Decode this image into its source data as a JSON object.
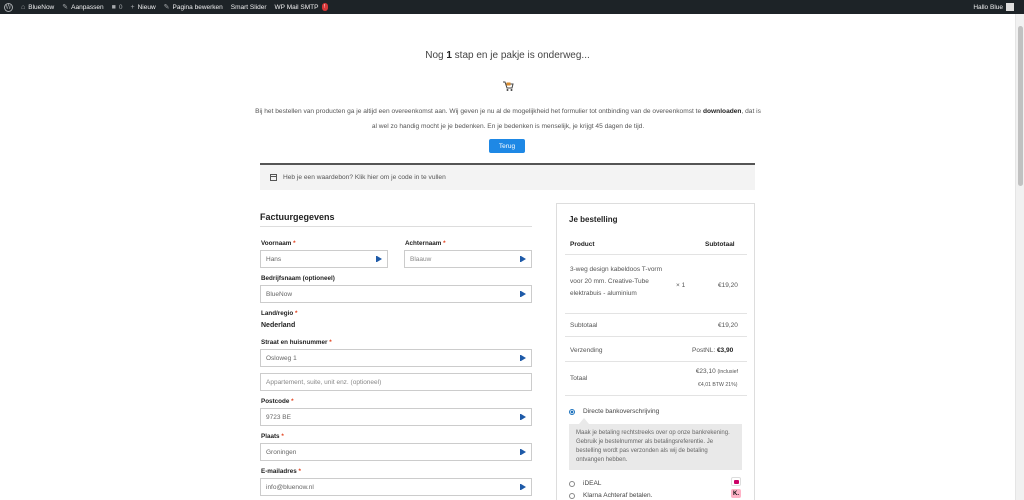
{
  "adminbar": {
    "site_name": "BlueNow",
    "customize": "Aanpassen",
    "comments_count": "0",
    "new": "Nieuw",
    "edit_page": "Pagina bewerken",
    "smart_slider": "Smart Slider",
    "wp_mail_smtp": "WP Mail SMTP",
    "smtp_badge": "!",
    "greeting": "Hallo Blue"
  },
  "hero": {
    "headline_prefix": "Nog ",
    "headline_bold": "1",
    "headline_suffix": " stap en je pakje is onderweg...",
    "intro_part1": "Bij het bestellen van producten ga je altijd een overeenkomst aan. Wij geven je nu al de mogelijkheid het formulier tot ontbinding van de overeenkomst te ",
    "intro_bold": "downloaden",
    "intro_part2": ", dat is al wel zo handig mocht je je bedenken. En je bedenken is menselijk, je krijgt 45 dagen de tijd.",
    "back_button": "Terug"
  },
  "coupon": {
    "text": "Heb je een waardebon? Klik hier om je code in te vullen"
  },
  "billing": {
    "title": "Factuurgegevens",
    "required_mark": "*",
    "first_name_label": "Voornaam",
    "first_name_value": "Hans",
    "last_name_label": "Achternaam",
    "last_name_value": "Blaauw",
    "company_label": "Bedrijfsnaam (optioneel)",
    "company_value": "BlueNow",
    "country_label": "Land/regio",
    "country_value": "Nederland",
    "street_label": "Straat en huisnummer",
    "street_value": "Osloweg 1",
    "street2_placeholder": "Appartement, suite, unit enz. (optioneel)",
    "postcode_label": "Postcode",
    "postcode_value": "9723 BE",
    "city_label": "Plaats",
    "city_value": "Groningen",
    "email_label": "E-mailadres",
    "email_value": "info@bluenow.nl"
  },
  "order": {
    "title": "Je bestelling",
    "col_product": "Product",
    "col_subtotal": "Subtotaal",
    "item_line1": "3-weg design kabeldoos T-vorm",
    "item_line2": "voor 20 mm. Creative-Tube",
    "item_line3": "elektrabuis - aluminium",
    "item_qty": "× 1",
    "item_price": "€19,20",
    "subtotal_label": "Subtotaal",
    "subtotal_value": "€19,20",
    "shipping_label": "Verzending",
    "shipping_method": "PostNL: ",
    "shipping_value": "€3,90",
    "total_label": "Totaal",
    "total_value": "€23,10",
    "total_incl": "(inclusief",
    "total_tax": "€4,01 BTW 21%)"
  },
  "payment": {
    "bank_label": "Directe bankoverschrijving",
    "bank_desc": "Maak je betaling rechtstreeks over op onze bankrekening. Gebruik je bestelnummer als betalingsreferentie. Je bestelling wordt pas verzonden als wij de betaling ontvangen hebben.",
    "ideal_label": "iDEAL",
    "klarna_label": "Klarna Achteraf betalen.",
    "klarna_logo_text": "K."
  },
  "colors": {
    "accent": "#1e88e5",
    "adminbar": "#1d2327",
    "required": "#e2401c",
    "ideal_pink": "#cc0066",
    "klarna_pink": "#ffb3c7"
  }
}
